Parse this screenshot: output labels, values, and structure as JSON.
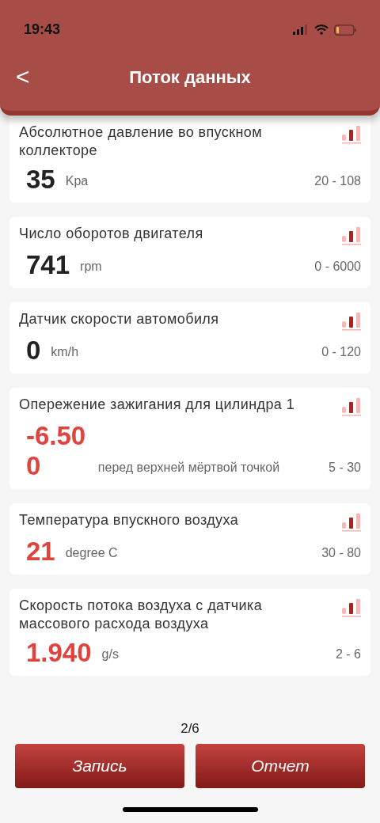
{
  "status_bar": {
    "time": "19:43"
  },
  "header": {
    "back": "<",
    "title": "Поток данных"
  },
  "sensors": [
    {
      "name": "Абсолютное давление во впускном коллекторе",
      "value": "35",
      "unit": "Kpa",
      "range": "20 - 108",
      "out_of_range": false
    },
    {
      "name": "Число оборотов двигателя",
      "value": "741",
      "unit": "rpm",
      "range": "0 - 6000",
      "out_of_range": false
    },
    {
      "name": "Датчик скорости автомобиля",
      "value": "0",
      "unit": "km/h",
      "range": "0 - 120",
      "out_of_range": false
    },
    {
      "name": "Опережение зажигания для цилиндра 1",
      "value": "-6.500",
      "unit": "перед верхней мёртвой точкой",
      "range": "5 - 30",
      "out_of_range": true
    },
    {
      "name": "Температура впускного воздуха",
      "value": "21",
      "unit": "degree C",
      "range": "30 - 80",
      "out_of_range": true
    },
    {
      "name": "Скорость потока воздуха с датчика массового расхода воздуха",
      "value": "1.940",
      "unit": "g/s",
      "range": "2 - 6",
      "out_of_range": true
    }
  ],
  "pager": "2/6",
  "buttons": [
    "Запись",
    "Отчет"
  ]
}
